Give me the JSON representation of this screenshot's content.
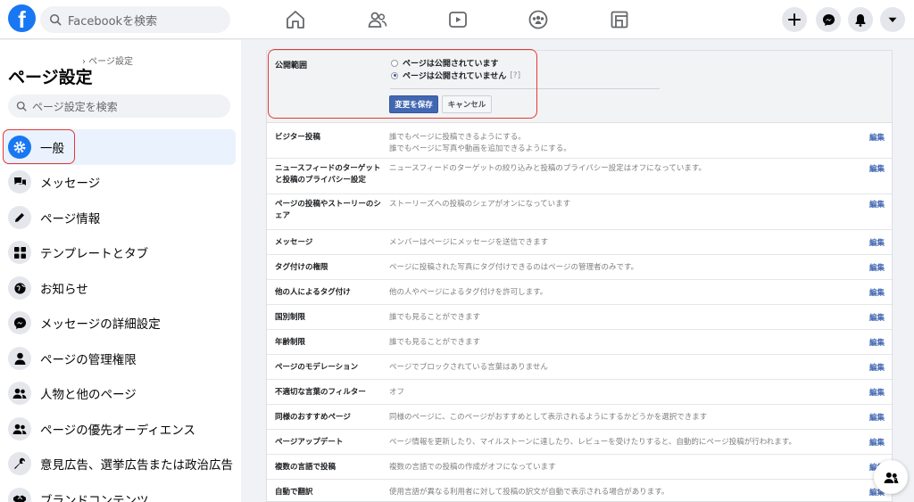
{
  "topbar": {
    "logo": "f",
    "search_placeholder": "Facebookを検索",
    "nav_icons": [
      "home-icon",
      "friends-icon",
      "watch-icon",
      "groups-icon",
      "gaming-icon"
    ],
    "right_icons": [
      "plus-icon",
      "messenger-icon",
      "bell-icon",
      "caret-down-icon"
    ]
  },
  "sidebar": {
    "breadcrumb": "› ページ設定",
    "title": "ページ設定",
    "search_placeholder": "ページ設定を検索",
    "items": [
      {
        "label": "一般",
        "icon": "gear-icon",
        "active": true
      },
      {
        "label": "メッセージ",
        "icon": "chat-bubbles-icon"
      },
      {
        "label": "ページ情報",
        "icon": "pencil-icon"
      },
      {
        "label": "テンプレートとタブ",
        "icon": "grid-icon"
      },
      {
        "label": "お知らせ",
        "icon": "globe-icon"
      },
      {
        "label": "メッセージの詳細設定",
        "icon": "messenger-icon"
      },
      {
        "label": "ページの管理権限",
        "icon": "person-icon"
      },
      {
        "label": "人物と他のページ",
        "icon": "people-icon"
      },
      {
        "label": "ページの優先オーディエンス",
        "icon": "people-icon"
      },
      {
        "label": "意見広告、選挙広告または政治広告",
        "icon": "wrench-icon"
      },
      {
        "label": "ブランドコンテンツ",
        "icon": "handshake-icon"
      }
    ]
  },
  "visibility": {
    "label": "公開範囲",
    "option_public": "ページは公開されています",
    "option_unpublished": "ページは公開されていません",
    "help": "[?]",
    "selected": "unpublished",
    "save_label": "変更を保存",
    "cancel_label": "キャンセル"
  },
  "settings": [
    {
      "label": "ビジター投稿",
      "value": "誰でもページに投稿できるようにする。\n誰でもページに写真や動画を追加できるようにする。",
      "edit": "編集"
    },
    {
      "label": "ニュースフィードのターゲットと投稿のプライバシー設定",
      "value": "ニュースフィードのターゲットの絞り込みと投稿のプライバシー設定はオフになっています。",
      "edit": "編集"
    },
    {
      "label": "ページの投稿やストーリーのシェア",
      "value": "ストーリーズへの投稿のシェアがオンになっています",
      "edit": "編集"
    },
    {
      "label": "メッセージ",
      "value": "メンバーはページにメッセージを送信できます",
      "edit": "編集"
    },
    {
      "label": "タグ付けの権限",
      "value": "ページに投稿された写真にタグ付けできるのはページの管理者のみです。",
      "edit": "編集"
    },
    {
      "label": "他の人によるタグ付け",
      "value": "他の人やページによるタグ付けを許可します。",
      "edit": "編集"
    },
    {
      "label": "国別制限",
      "value": "誰でも見ることができます",
      "edit": "編集"
    },
    {
      "label": "年齢制限",
      "value": "誰でも見ることができます",
      "edit": "編集"
    },
    {
      "label": "ページのモデレーション",
      "value": "ページでブロックされている言葉はありません",
      "edit": "編集"
    },
    {
      "label": "不適切な言葉のフィルター",
      "value": "オフ",
      "edit": "編集"
    },
    {
      "label": "同様のおすすめページ",
      "value": "同様のページに、このページがおすすめとして表示されるようにするかどうかを選択できます",
      "edit": "編集"
    },
    {
      "label": "ページアップデート",
      "value": "ページ情報を更新したり、マイルストーンに達したり、レビューを受けたりすると、自動的にページ投稿が行われます。",
      "edit": "編集"
    },
    {
      "label": "複数の言語で投稿",
      "value": "複数の言語での投稿の作成がオフになっています",
      "edit": "編集"
    },
    {
      "label": "自動で翻訳",
      "value": "使用言語が異なる利用者に対して投稿の訳文が自動で表示される場合があります。",
      "edit": "編集"
    }
  ],
  "float_chat": {
    "icon": "people-icon",
    "count": "2"
  },
  "colors": {
    "brand": "#1877f2",
    "save_button": "#4267b2",
    "highlight": "#e53935"
  }
}
